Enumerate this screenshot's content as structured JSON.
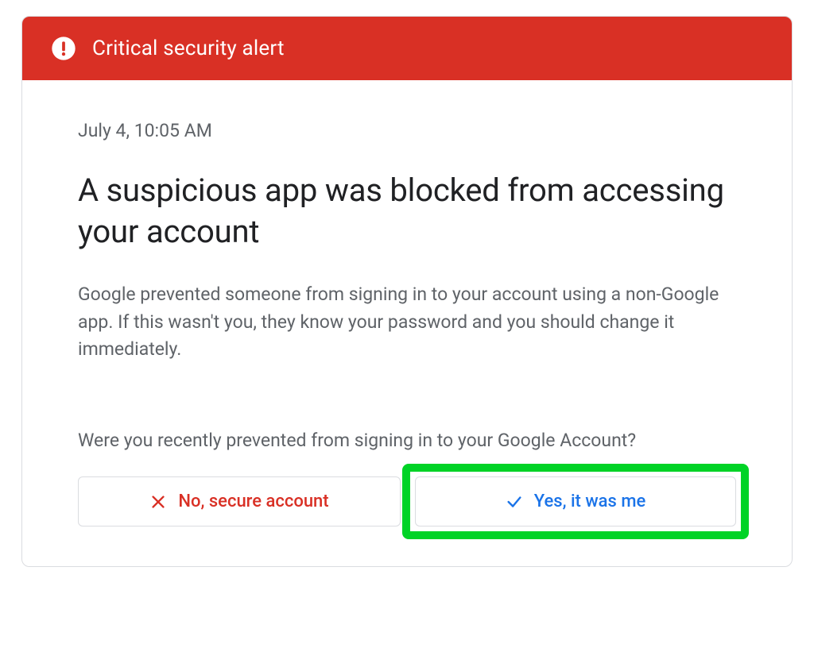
{
  "alert": {
    "title": "Critical security alert"
  },
  "body": {
    "timestamp": "July 4, 10:05 AM",
    "headline": "A suspicious app was blocked from accessing your account",
    "text": "Google prevented someone from signing in to your account using a non-Google app. If this wasn't you, they know your password and you should change it immediately.",
    "question": "Were you recently prevented from signing in to your Google Account?",
    "no_label": "No, secure account",
    "yes_label": "Yes, it was me"
  }
}
